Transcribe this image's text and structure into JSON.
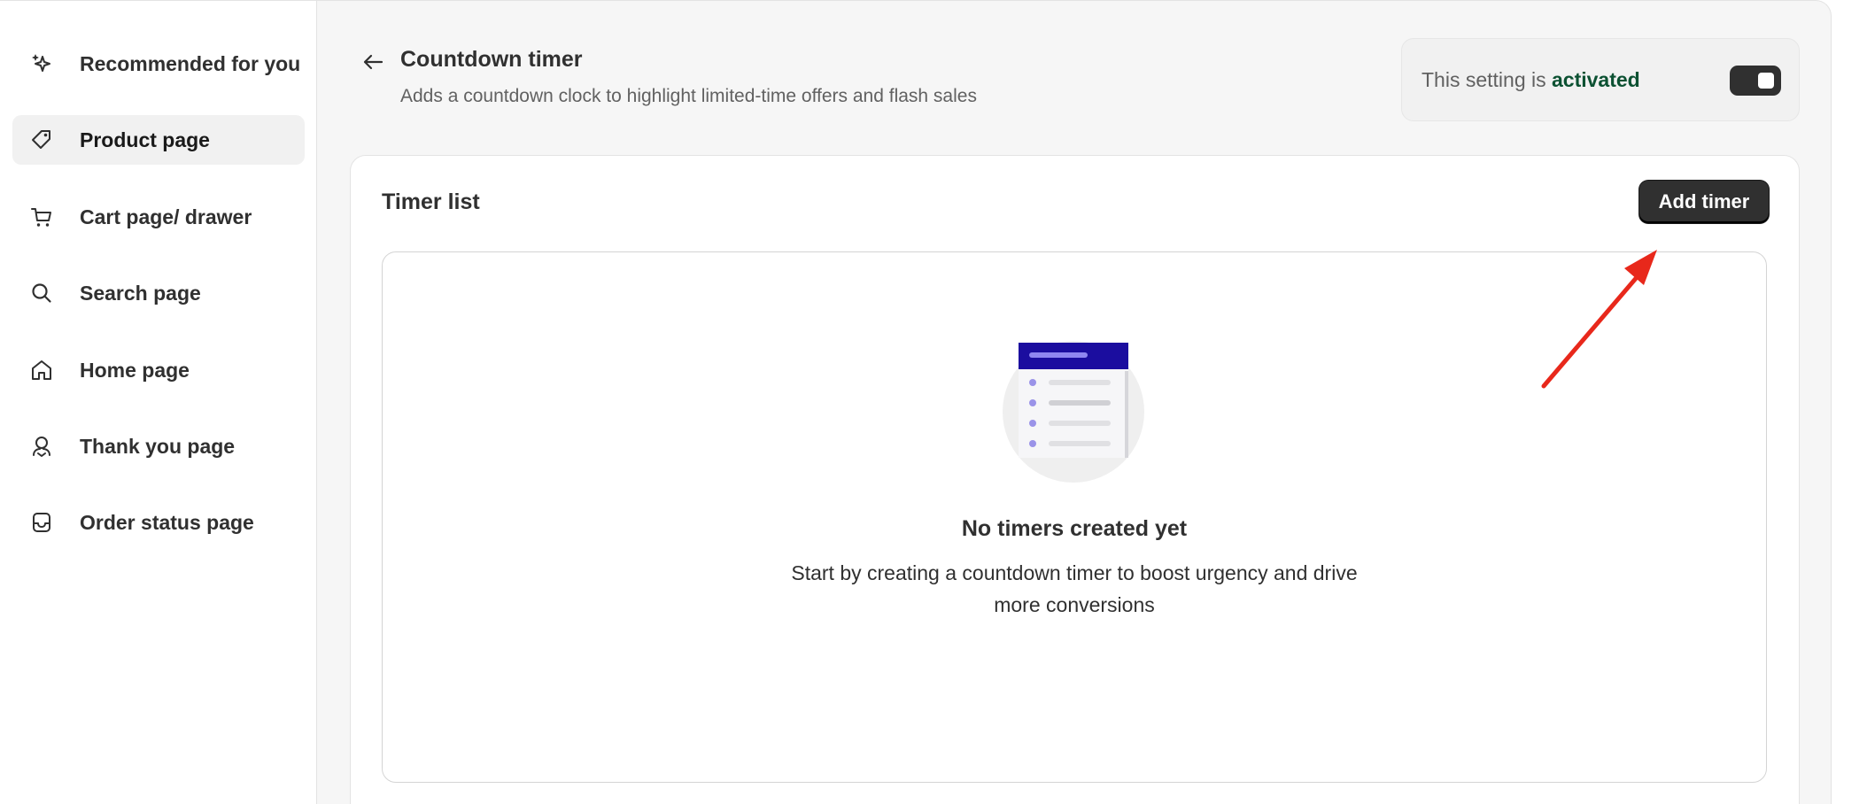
{
  "sidebar": {
    "items": [
      {
        "label": "Recommended for you",
        "icon": "sparkle-icon",
        "active": false
      },
      {
        "label": "Product page",
        "icon": "tag-icon",
        "active": true
      },
      {
        "label": "Cart page/ drawer",
        "icon": "cart-icon",
        "active": false
      },
      {
        "label": "Search page",
        "icon": "search-icon",
        "active": false
      },
      {
        "label": "Home page",
        "icon": "home-icon",
        "active": false
      },
      {
        "label": "Thank you page",
        "icon": "thank-you-icon",
        "active": false
      },
      {
        "label": "Order status page",
        "icon": "inbox-icon",
        "active": false
      }
    ]
  },
  "header": {
    "title": "Countdown timer",
    "subtitle": "Adds a countdown clock to highlight limited-time offers and flash sales",
    "status_prefix": "This setting is",
    "status_value": "activated",
    "toggle_on": true
  },
  "timer_list": {
    "title": "Timer list",
    "add_button_label": "Add timer",
    "empty_heading": "No timers created yet",
    "empty_text_line1": "Start by creating a countdown timer to boost urgency and drive",
    "empty_text_line2": "more conversions"
  },
  "colors": {
    "accent_dark": "#303030",
    "status_activated": "#0c5132",
    "illustration_header": "#1b0d9f",
    "annotation_arrow": "#e8281b"
  }
}
